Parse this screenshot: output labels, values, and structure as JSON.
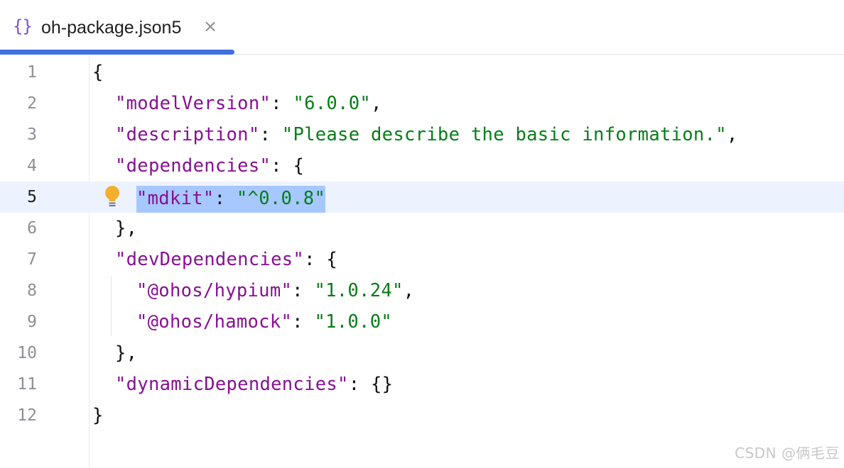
{
  "tab": {
    "icon": "{}",
    "icon_name": "json-braces-icon",
    "label": "oh-package.json5",
    "close_glyph": "×",
    "accent_color": "#3d6fe0"
  },
  "editor": {
    "current_line": 5,
    "lines": [
      {
        "number": "1",
        "tokens": [
          {
            "t": "p",
            "v": "{"
          }
        ]
      },
      {
        "number": "2",
        "tokens": [
          {
            "t": "k",
            "v": "\"modelVersion\""
          },
          {
            "t": "p",
            "v": ": "
          },
          {
            "t": "s",
            "v": "\"6.0.0\""
          },
          {
            "t": "p",
            "v": ","
          }
        ]
      },
      {
        "number": "3",
        "tokens": [
          {
            "t": "k",
            "v": "\"description\""
          },
          {
            "t": "p",
            "v": ": "
          },
          {
            "t": "s",
            "v": "\"Please describe the basic information.\""
          },
          {
            "t": "p",
            "v": ","
          }
        ]
      },
      {
        "number": "4",
        "tokens": [
          {
            "t": "k",
            "v": "\"dependencies\""
          },
          {
            "t": "p",
            "v": ": {"
          }
        ]
      },
      {
        "number": "5",
        "tokens": [
          {
            "t": "k",
            "v": "\"mdkit\""
          },
          {
            "t": "p",
            "v": ": "
          },
          {
            "t": "s",
            "v": "\"^0.0.8\""
          }
        ]
      },
      {
        "number": "6",
        "tokens": [
          {
            "t": "p",
            "v": "},"
          }
        ]
      },
      {
        "number": "7",
        "tokens": [
          {
            "t": "k",
            "v": "\"devDependencies\""
          },
          {
            "t": "p",
            "v": ": {"
          }
        ]
      },
      {
        "number": "8",
        "tokens": [
          {
            "t": "k",
            "v": "\"@ohos/hypium\""
          },
          {
            "t": "p",
            "v": ": "
          },
          {
            "t": "s",
            "v": "\"1.0.24\""
          },
          {
            "t": "p",
            "v": ","
          }
        ]
      },
      {
        "number": "9",
        "tokens": [
          {
            "t": "k",
            "v": "\"@ohos/hamock\""
          },
          {
            "t": "p",
            "v": ": "
          },
          {
            "t": "s",
            "v": "\"1.0.0\""
          }
        ]
      },
      {
        "number": "10",
        "tokens": [
          {
            "t": "p",
            "v": "},"
          }
        ]
      },
      {
        "number": "11",
        "tokens": [
          {
            "t": "k",
            "v": "\"dynamicDependencies\""
          },
          {
            "t": "p",
            "v": ": {}"
          }
        ]
      },
      {
        "number": "12",
        "tokens": [
          {
            "t": "p",
            "v": "}"
          }
        ]
      }
    ],
    "intention_icon": "lightbulb-icon"
  },
  "colors": {
    "key": "#871094",
    "string": "#067d17",
    "selection": "#a6c8ff",
    "current_line_bg": "#edf3fe"
  },
  "watermark": "CSDN @俩毛豆"
}
